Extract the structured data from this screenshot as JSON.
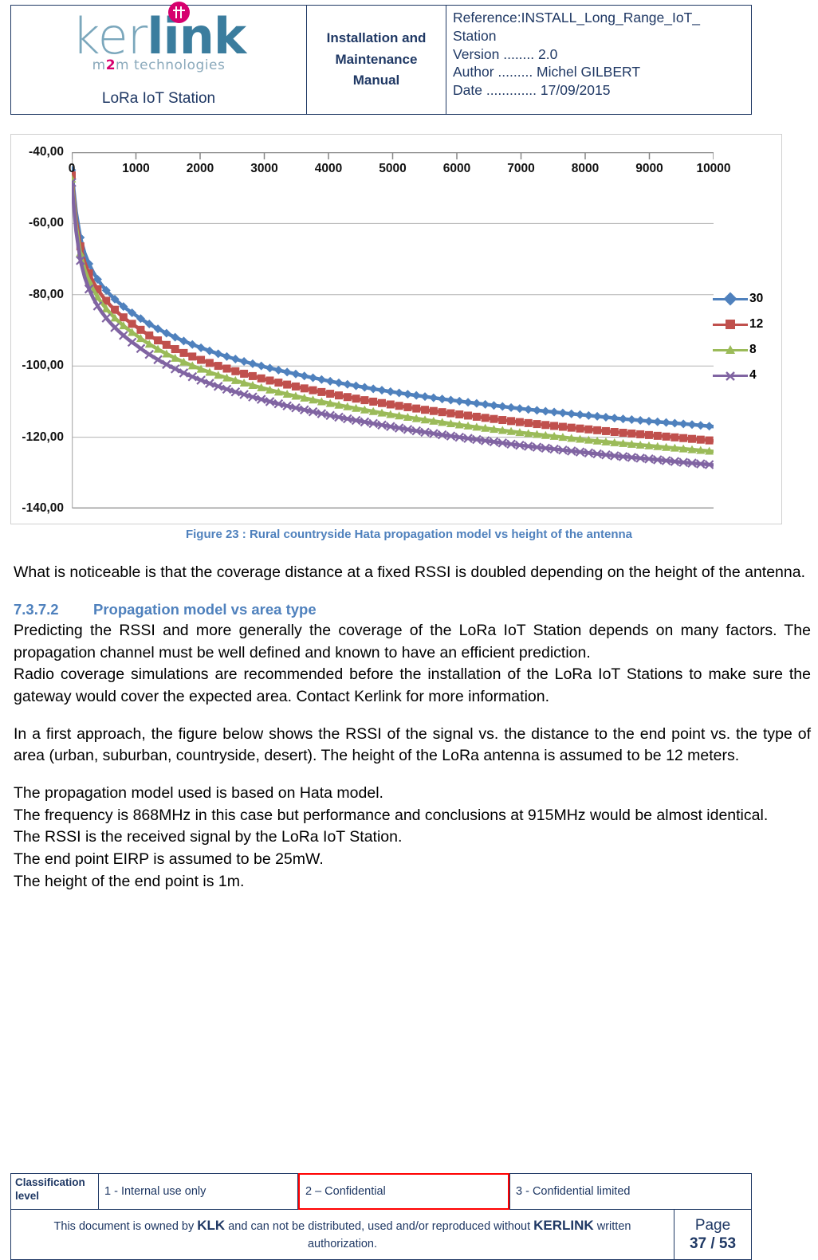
{
  "header": {
    "logo": {
      "part1": "ker",
      "part2": "link",
      "tagline_pre": "m",
      "tagline_num": "2",
      "tagline_post": "m technologies",
      "sub": "LoRa IoT Station"
    },
    "doc_title": "Installation and Maintenance Manual",
    "meta": {
      "reference": "Reference:INSTALL_Long_Range_IoT_",
      "reference_cont": "Station",
      "version": "Version ........ 2.0",
      "author": "Author ......... Michel GILBERT",
      "date": "Date ............. 17/09/2015"
    }
  },
  "figure": {
    "caption": "Figure 23 : Rural countryside Hata propagation model vs height of the antenna"
  },
  "chart_data": {
    "type": "line",
    "title": "",
    "xlabel": "",
    "ylabel": "",
    "xlim": [
      0,
      10000
    ],
    "ylim": [
      -140,
      -40
    ],
    "xticks": [
      0,
      1000,
      2000,
      3000,
      4000,
      5000,
      6000,
      7000,
      8000,
      9000,
      10000
    ],
    "yticks": [
      "-40,00",
      "-60,00",
      "-80,00",
      "-100,00",
      "-120,00",
      "-140,00"
    ],
    "ytick_values": [
      -40,
      -60,
      -80,
      -100,
      -120,
      -140
    ],
    "grid": true,
    "x_axis_position": "top",
    "legend_position": "right",
    "colors": {
      "s30": "#4f81bd",
      "s12": "#c0504d",
      "s8": "#9bbb59",
      "s4": "#8064a2"
    },
    "x": [
      20,
      50,
      100,
      200,
      300,
      500,
      700,
      1000,
      1500,
      2000,
      2500,
      3000,
      3500,
      4000,
      4500,
      5000,
      5500,
      6000,
      6500,
      7000,
      7500,
      8000,
      8500,
      9000,
      9500,
      10000
    ],
    "series": [
      {
        "name": "30",
        "marker": "diamond",
        "color": "#4f81bd",
        "values": [
          -45.0,
          -53.5,
          -60.8,
          -68.2,
          -72.5,
          -78.0,
          -81.7,
          -85.8,
          -91.0,
          -94.8,
          -97.8,
          -100.2,
          -102.3,
          -104.2,
          -105.8,
          -107.3,
          -108.6,
          -109.8,
          -110.9,
          -112.0,
          -112.9,
          -113.8,
          -114.7,
          -115.5,
          -116.2,
          -117.0
        ]
      },
      {
        "name": "12",
        "marker": "square",
        "color": "#c0504d",
        "values": [
          -46.5,
          -55.5,
          -63.2,
          -70.8,
          -75.2,
          -80.9,
          -84.7,
          -88.9,
          -94.3,
          -98.2,
          -101.2,
          -103.7,
          -105.8,
          -107.7,
          -109.4,
          -110.9,
          -112.3,
          -113.5,
          -114.7,
          -115.8,
          -116.8,
          -117.7,
          -118.6,
          -119.4,
          -120.2,
          -121.0
        ]
      },
      {
        "name": "8",
        "marker": "triangle",
        "color": "#9bbb59",
        "values": [
          -47.5,
          -57.0,
          -65.0,
          -72.8,
          -77.3,
          -83.1,
          -87.0,
          -91.3,
          -96.8,
          -100.8,
          -103.8,
          -106.3,
          -108.5,
          -110.4,
          -112.1,
          -113.7,
          -115.1,
          -116.4,
          -117.6,
          -118.7,
          -119.7,
          -120.7,
          -121.6,
          -122.4,
          -123.2,
          -124.0
        ]
      },
      {
        "name": "4",
        "marker": "cross",
        "color": "#8064a2",
        "values": [
          -48.5,
          -58.5,
          -67.0,
          -75.0,
          -79.7,
          -85.7,
          -89.7,
          -94.1,
          -99.8,
          -103.9,
          -107.0,
          -109.6,
          -111.8,
          -113.8,
          -115.5,
          -117.1,
          -118.6,
          -119.9,
          -121.1,
          -122.3,
          -123.3,
          -124.3,
          -125.3,
          -126.1,
          -127.0,
          -127.8
        ]
      }
    ]
  },
  "body": {
    "para1": "What is noticeable is that the coverage distance at a fixed RSSI is doubled depending on the height of the antenna.",
    "section_number": "7.3.7.2",
    "section_title": "Propagation model vs area type",
    "para2": "Predicting the RSSI and more generally the coverage of the LoRa IoT Station depends on many factors. The propagation channel must be well defined and known to have an efficient prediction.",
    "para3": "Radio coverage simulations are recommended before the installation of the LoRa IoT Stations to make sure the gateway would cover the expected area. Contact Kerlink for more information.",
    "para4": "In a first approach, the figure below shows the RSSI of the signal vs. the distance to the end point vs. the type of area (urban, suburban, countryside, desert). The height of the LoRa antenna is assumed to be 12 meters.",
    "line1": "The propagation model used is based on Hata model.",
    "line2": "The frequency is 868MHz in this case but performance and conclusions at 915MHz would be almost identical.",
    "line3": "The RSSI is the received signal by the LoRa IoT Station.",
    "line4": "The end point EIRP is assumed to be 25mW.",
    "line5": "The height of the end point is 1m."
  },
  "footer": {
    "classification_label": "Classification level",
    "level1": "1 - Internal use only",
    "level2": "2 – Confidential",
    "level3": "3 - Confidential limited",
    "notice_pre": "This document is owned by ",
    "notice_klk": "KLK",
    "notice_mid": " and can not be distributed, used and/or reproduced  without ",
    "notice_kerlink": "KERLINK",
    "notice_post": " written authorization.",
    "page_label": "Page",
    "page_value": "37 / 53"
  }
}
